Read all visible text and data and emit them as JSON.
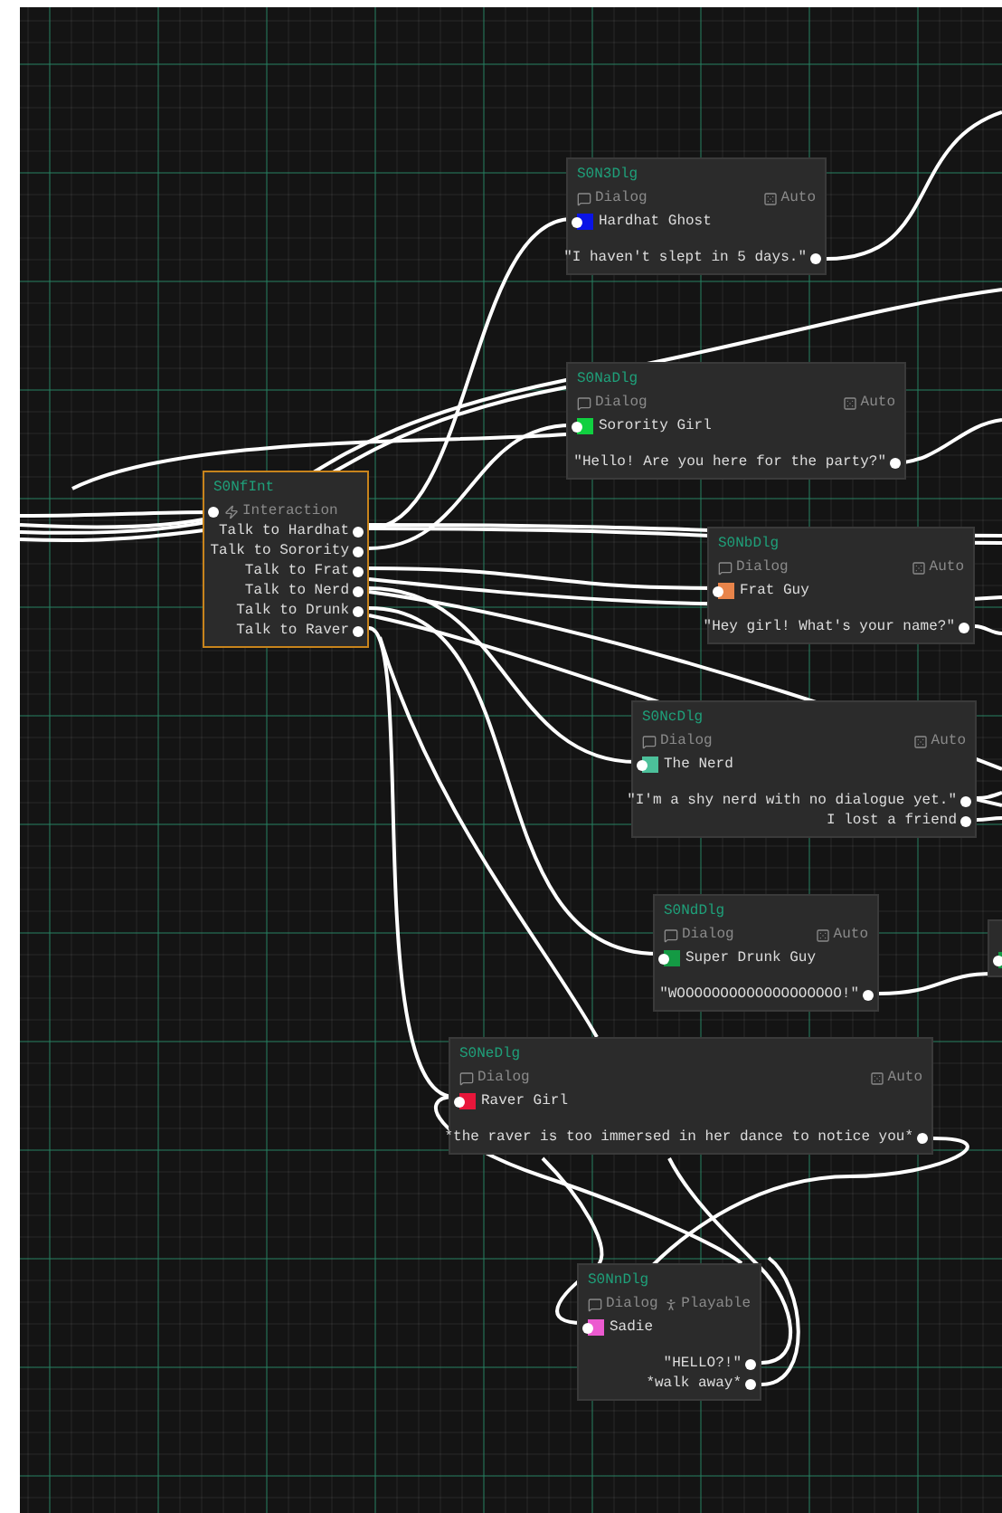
{
  "nodes": [
    {
      "kind": "dialog",
      "id": "S0N3Dlg",
      "selected": false,
      "type": "Dialog",
      "badge": {
        "kind": "auto",
        "label": "Auto"
      },
      "character": {
        "name": "Hardhat Ghost",
        "color": "#0a14e6"
      },
      "outputs": [
        "\"I haven't slept in 5 days.\""
      ]
    },
    {
      "kind": "dialog",
      "id": "S0NaDlg",
      "selected": false,
      "type": "Dialog",
      "badge": {
        "kind": "auto",
        "label": "Auto"
      },
      "character": {
        "name": "Sorority Girl",
        "color": "#10d040"
      },
      "outputs": [
        "\"Hello! Are you here for the party?\""
      ]
    },
    {
      "kind": "interaction",
      "id": "S0NfInt",
      "selected": true,
      "type": "Interaction",
      "outputs": [
        "Talk to Hardhat",
        "Talk to Sorority",
        "Talk to Frat",
        "Talk to Nerd",
        "Talk to Drunk",
        "Talk to Raver"
      ]
    },
    {
      "kind": "dialog",
      "id": "S0NbDlg",
      "selected": false,
      "type": "Dialog",
      "badge": {
        "kind": "auto",
        "label": "Auto"
      },
      "character": {
        "name": "Frat Guy",
        "color": "#e8844a"
      },
      "outputs": [
        "\"Hey girl! What's your name?\""
      ]
    },
    {
      "kind": "dialog",
      "id": "S0NcDlg",
      "selected": false,
      "type": "Dialog",
      "badge": {
        "kind": "auto",
        "label": "Auto"
      },
      "character": {
        "name": "The Nerd",
        "color": "#4cc09a"
      },
      "outputs": [
        "\"I'm a shy nerd with no dialogue yet.\"",
        "I lost a friend"
      ]
    },
    {
      "kind": "dialog",
      "id": "S0NdDlg",
      "selected": false,
      "type": "Dialog",
      "badge": {
        "kind": "auto",
        "label": "Auto"
      },
      "character": {
        "name": "Super Drunk Guy",
        "color": "#149a44"
      },
      "outputs": [
        "\"WOOOOOOOOOOOOOOOOOOO!\""
      ]
    },
    {
      "kind": "dialog",
      "selected": false,
      "character": {
        "color": "#149a44"
      }
    },
    {
      "kind": "dialog",
      "id": "S0NeDlg",
      "selected": false,
      "type": "Dialog",
      "badge": {
        "kind": "auto",
        "label": "Auto"
      },
      "character": {
        "name": "Raver Girl",
        "color": "#e8163a"
      },
      "outputs": [
        "*the raver is too immersed in her dance to notice you*"
      ]
    },
    {
      "kind": "dialog",
      "id": "S0NnDlg",
      "selected": false,
      "type": "Dialog",
      "badge": {
        "kind": "playable",
        "label": "Playable"
      },
      "character": {
        "name": "Sadie",
        "color": "#ec5ad0"
      },
      "outputs": [
        "\"HELLO?!\"",
        "*walk away*"
      ]
    }
  ]
}
